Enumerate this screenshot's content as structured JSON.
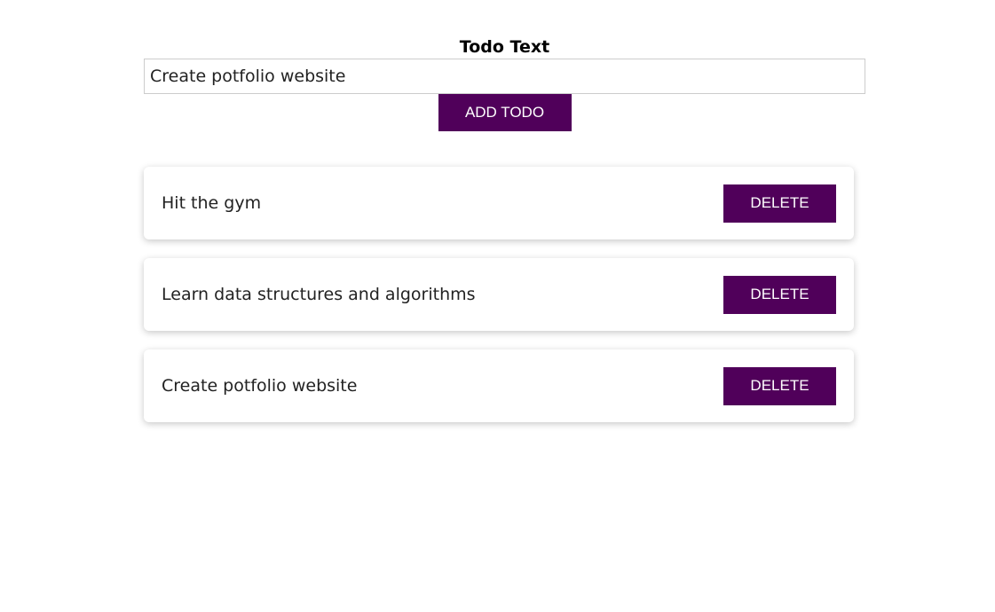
{
  "form": {
    "label": "Todo Text",
    "input_value": "Create potfolio website",
    "add_button_label": "ADD TODO"
  },
  "todos": [
    {
      "text": "Hit the gym",
      "delete_label": "DELETE"
    },
    {
      "text": "Learn data structures and algorithms",
      "delete_label": "DELETE"
    },
    {
      "text": "Create potfolio website",
      "delete_label": "DELETE"
    }
  ],
  "colors": {
    "accent": "#50005a",
    "button_text": "#ffffff",
    "input_border": "#cccccc"
  }
}
